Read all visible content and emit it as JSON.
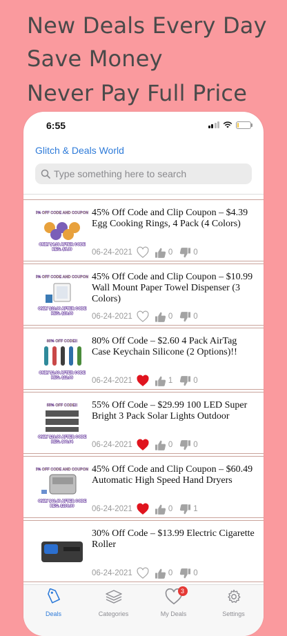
{
  "promo": {
    "line1": "New Deals Every Day",
    "line2": "Save Money",
    "line3": "Never Pay Full Price"
  },
  "status_bar": {
    "time": "6:55"
  },
  "app": {
    "title": "Glitch & Deals World"
  },
  "search": {
    "placeholder": "Type something here to search"
  },
  "deals": [
    {
      "title": "45% Off Code and Clip Coupon – $4.39 Egg Cooking Rings, 4 Pack (4 Colors)",
      "date": "06-24-2021",
      "liked": false,
      "thumbs_up": "0",
      "thumbs_down": "0",
      "thumb_banner": "45% OFF CODE AND COUPON!!",
      "thumb_price": "ONLY $4.39 AFTER CODE",
      "thumb_reg": "REG. $7.99"
    },
    {
      "title": "45% Off Code and Clip Coupon – $10.99 Wall Mount Paper Towel Dispenser (3 Colors)",
      "date": "06-24-2021",
      "liked": false,
      "thumbs_up": "0",
      "thumbs_down": "0",
      "thumb_banner": "45% OFF CODE AND COUPON!!",
      "thumb_price": "ONLY $10.99 AFTER CODE",
      "thumb_reg": "REG. $19.99"
    },
    {
      "title": "80% Off Code – $2.60 4 Pack AirTag Case Keychain Silicone (2 Options)!!",
      "date": "06-24-2021",
      "liked": true,
      "thumbs_up": "1",
      "thumbs_down": "0",
      "thumb_banner": "80% OFF CODE!!",
      "thumb_price": "ONLY $2.60 AFTER CODE",
      "thumb_reg": "REG. $12.99"
    },
    {
      "title": "55% Off Code – $29.99  100 LED Super Bright 3 Pack Solar Lights Outdoor",
      "date": "06-24-2021",
      "liked": true,
      "thumbs_up": "0",
      "thumbs_down": "0",
      "thumb_banner": "55% OFF CODE!!",
      "thumb_price": "ONLY $29.99 AFTER CODE",
      "thumb_reg": "REG. $66.64"
    },
    {
      "title": "45% Off Code and Clip Coupon – $60.49 Automatic High Speed Hand Dryers",
      "date": "06-24-2021",
      "liked": true,
      "thumbs_up": "0",
      "thumbs_down": "1",
      "thumb_banner": "45% OFF CODE AND COUPON!!",
      "thumb_price": "ONLY $60.49 AFTER CODE",
      "thumb_reg": "REG. $109.99"
    },
    {
      "title": "30% Off Code – $13.99 Electric Cigarette Roller",
      "date": "06-24-2021",
      "liked": false,
      "thumbs_up": "0",
      "thumbs_down": "0",
      "thumb_banner": "",
      "thumb_price": "",
      "thumb_reg": ""
    }
  ],
  "tabbar": {
    "tabs": [
      {
        "label": "Deals",
        "icon": "tag-icon",
        "active": true
      },
      {
        "label": "Categories",
        "icon": "layers-icon",
        "active": false
      },
      {
        "label": "My Deals",
        "icon": "heart-icon",
        "active": false,
        "badge": "3"
      },
      {
        "label": "Settings",
        "icon": "gear-icon",
        "active": false
      }
    ]
  },
  "colors": {
    "background": "#fa9a9e",
    "accent": "#2e7bd9",
    "heart_active": "#e0141e",
    "badge": "#e53935"
  }
}
